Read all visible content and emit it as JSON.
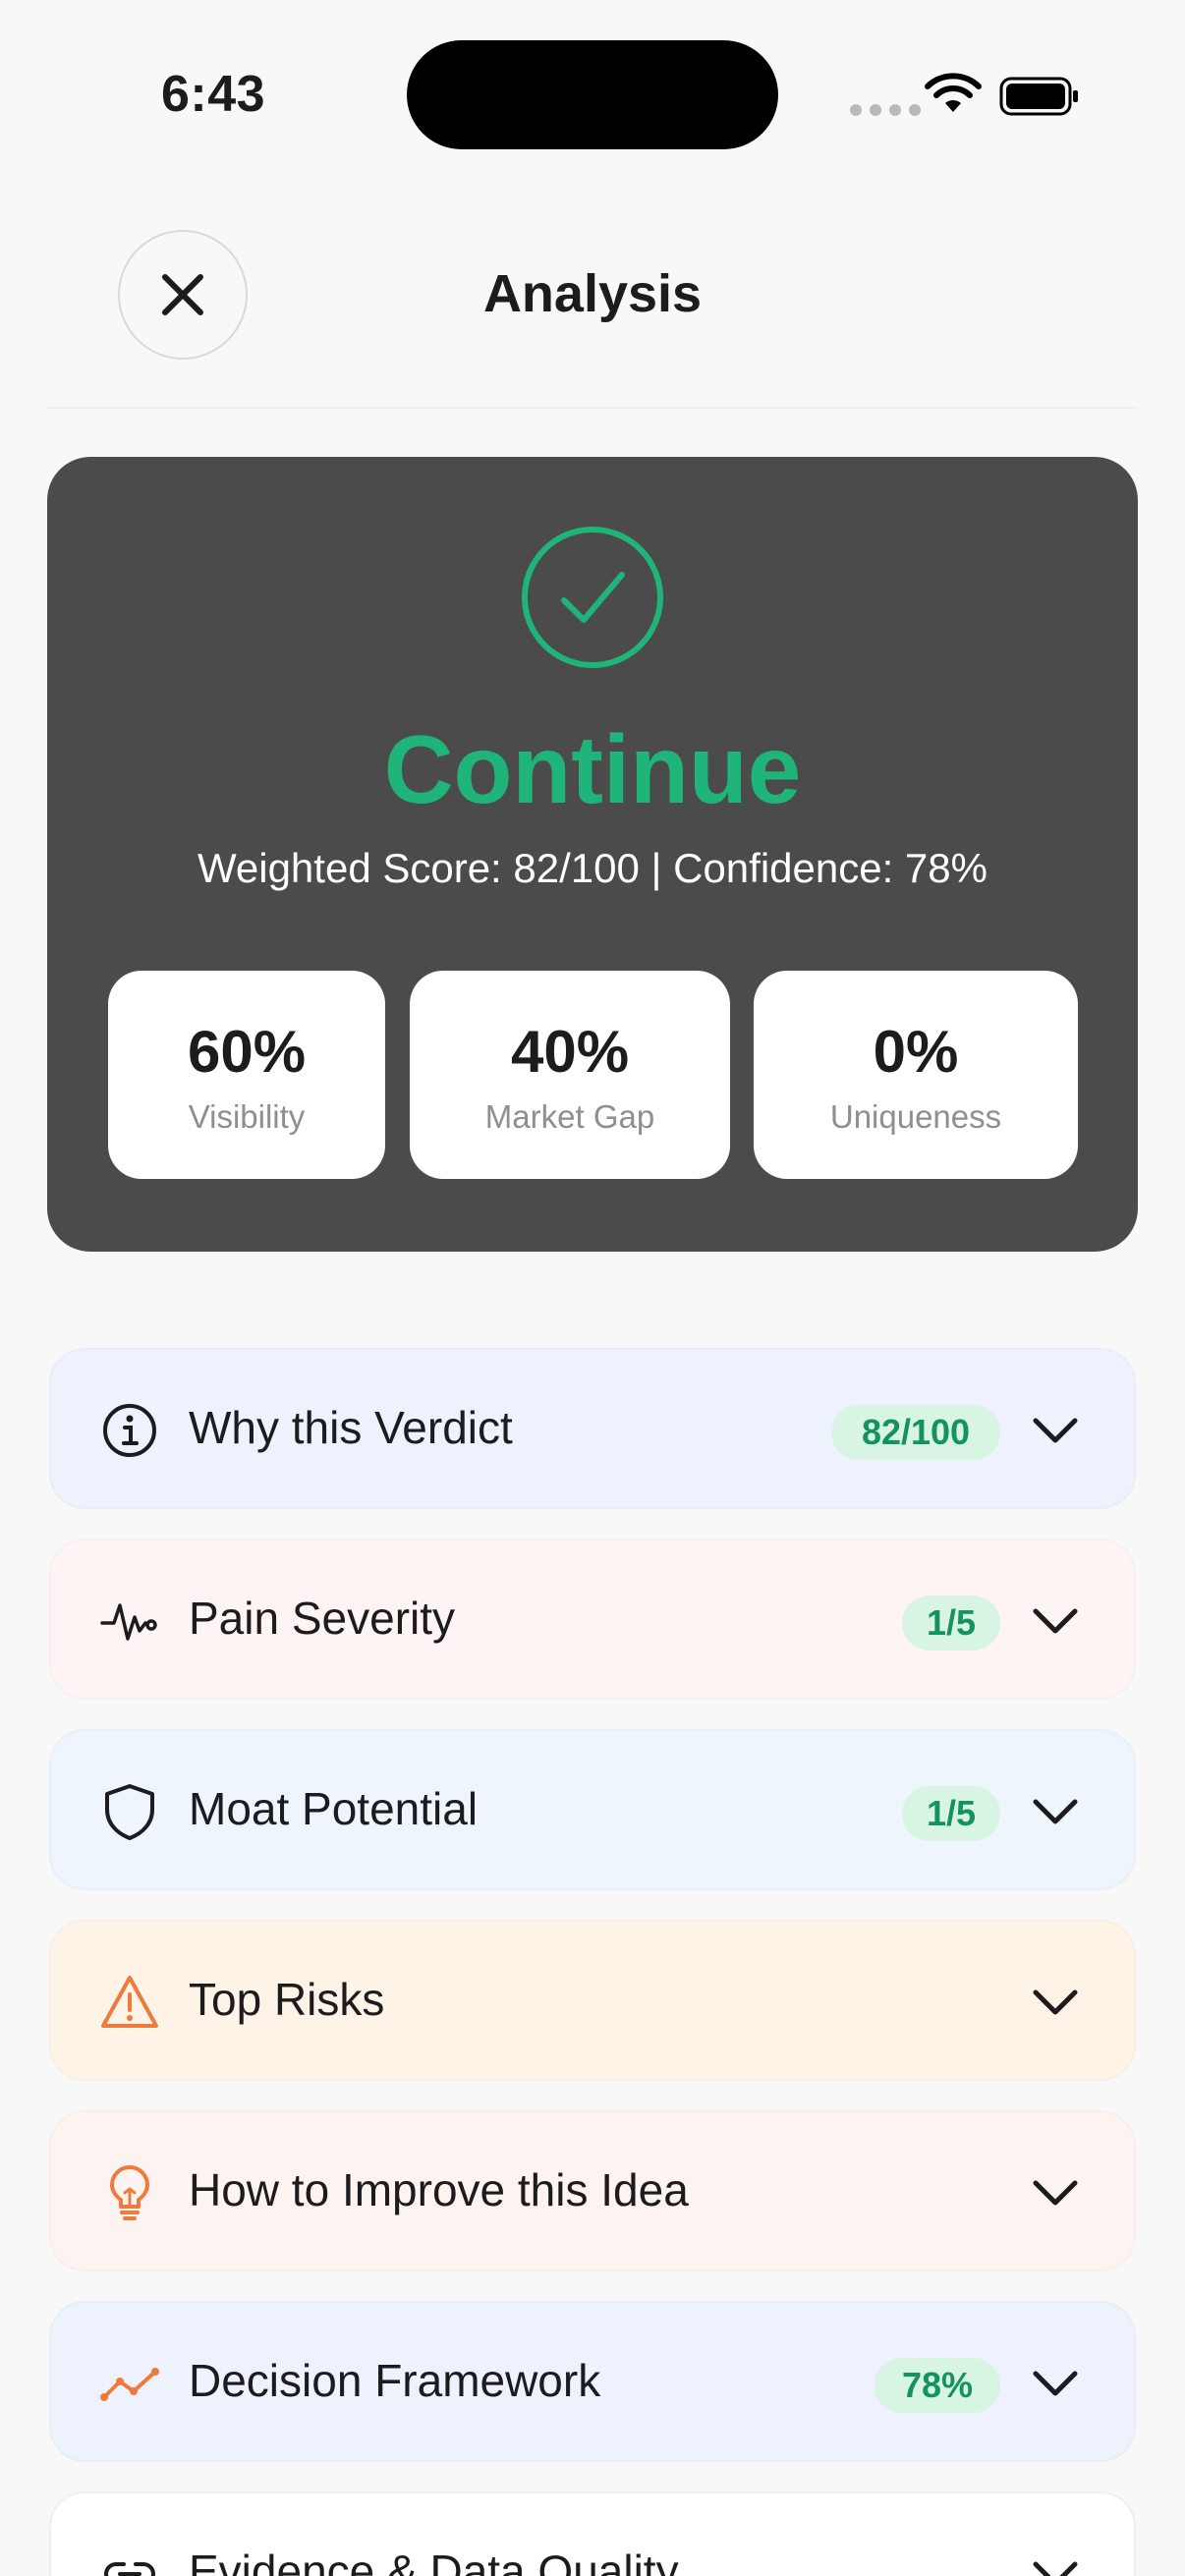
{
  "status_bar": {
    "time": "6:43"
  },
  "header": {
    "title": "Analysis",
    "close_icon": "close-icon"
  },
  "verdict": {
    "label": "Continue",
    "summary": "Weighted Score: 82/100 | Confidence: 78%",
    "accent_color": "#1fb57a",
    "metrics": [
      {
        "value": "60%",
        "label": "Visibility"
      },
      {
        "value": "40%",
        "label": "Market Gap"
      },
      {
        "value": "0%",
        "label": "Uniqueness"
      }
    ]
  },
  "sections": [
    {
      "label": "Why this Verdict",
      "badge": "82/100",
      "icon": "info-icon",
      "bg": "#eef2fd"
    },
    {
      "label": "Pain Severity",
      "badge": "1/5",
      "icon": "pulse-icon",
      "bg": "#fdf4f3"
    },
    {
      "label": "Moat Potential",
      "badge": "1/5",
      "icon": "shield-icon",
      "bg": "#eef5fd"
    },
    {
      "label": "Top Risks",
      "badge": "",
      "icon": "warning-icon",
      "bg": "#fdf3e6"
    },
    {
      "label": "How to Improve this Idea",
      "badge": "",
      "icon": "lightbulb-icon",
      "bg": "#fdf4f1"
    },
    {
      "label": "Decision Framework",
      "badge": "78%",
      "icon": "trend-icon",
      "bg": "#eef2fd"
    },
    {
      "label": "Evidence & Data Quality",
      "badge": "",
      "icon": "link-icon",
      "bg": "#ffffff"
    }
  ]
}
